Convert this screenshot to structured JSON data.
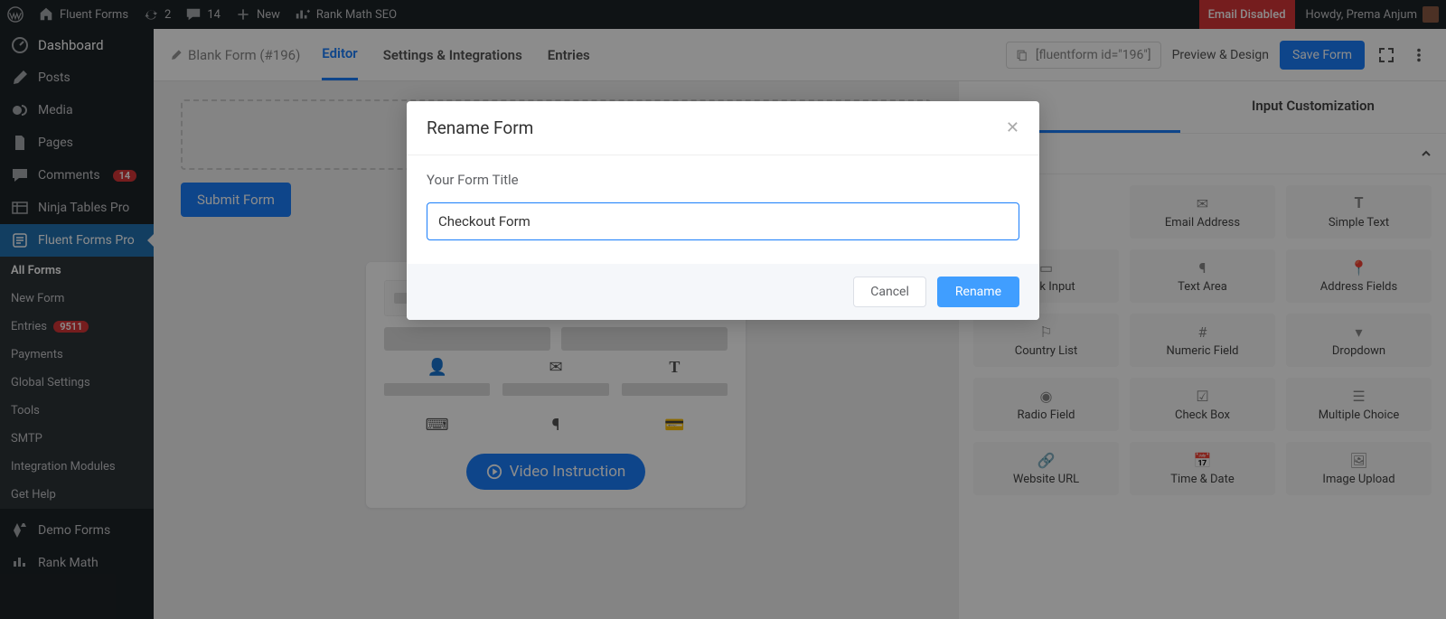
{
  "adminbar": {
    "site_name": "Fluent Forms",
    "updates": "2",
    "comments": "14",
    "new": "New",
    "rankmath": "Rank Math SEO",
    "email_disabled": "Email Disabled",
    "howdy": "Howdy, Prema Anjum"
  },
  "sidebar": {
    "items": [
      {
        "label": "Dashboard"
      },
      {
        "label": "Posts"
      },
      {
        "label": "Media"
      },
      {
        "label": "Pages"
      },
      {
        "label": "Comments",
        "badge": "14"
      },
      {
        "label": "Ninja Tables Pro"
      },
      {
        "label": "Fluent Forms Pro"
      }
    ],
    "subs": [
      {
        "label": "All Forms"
      },
      {
        "label": "New Form"
      },
      {
        "label": "Entries",
        "badge": "9511"
      },
      {
        "label": "Payments"
      },
      {
        "label": "Global Settings"
      },
      {
        "label": "Tools"
      },
      {
        "label": "SMTP"
      },
      {
        "label": "Integration Modules"
      },
      {
        "label": "Get Help"
      }
    ],
    "bottom": [
      {
        "label": "Demo Forms"
      },
      {
        "label": "Rank Math"
      }
    ]
  },
  "formbar": {
    "title": "Blank Form (#196)",
    "tabs": {
      "editor": "Editor",
      "settings": "Settings & Integrations",
      "entries": "Entries"
    },
    "shortcode": "[fluentform id=\"196\"]",
    "preview": "Preview & Design",
    "save": "Save Form"
  },
  "canvas": {
    "submit": "Submit Form",
    "video": "Video Instruction"
  },
  "right": {
    "tab_input": "Input Customization",
    "fields": [
      {
        "name": "email-address",
        "label": "Email Address",
        "glyph": "✉"
      },
      {
        "name": "simple-text",
        "label": "Simple Text",
        "glyph": "𝐓"
      },
      {
        "name": "mask-input",
        "label": "Mask Input",
        "glyph": "▭"
      },
      {
        "name": "text-area",
        "label": "Text Area",
        "glyph": "¶"
      },
      {
        "name": "address-fields",
        "label": "Address Fields",
        "glyph": "📍"
      },
      {
        "name": "country-list",
        "label": "Country List",
        "glyph": "⚐"
      },
      {
        "name": "numeric-field",
        "label": "Numeric Field",
        "glyph": "#"
      },
      {
        "name": "dropdown",
        "label": "Dropdown",
        "glyph": "▾"
      },
      {
        "name": "radio-field",
        "label": "Radio Field",
        "glyph": "◉"
      },
      {
        "name": "check-box",
        "label": "Check Box",
        "glyph": "☑"
      },
      {
        "name": "multiple-choice",
        "label": "Multiple Choice",
        "glyph": "☰"
      },
      {
        "name": "website-url",
        "label": "Website URL",
        "glyph": "🔗"
      },
      {
        "name": "time-date",
        "label": "Time & Date",
        "glyph": "📅"
      },
      {
        "name": "image-upload",
        "label": "Image Upload",
        "glyph": "🖼"
      }
    ]
  },
  "modal": {
    "title": "Rename Form",
    "label": "Your Form Title",
    "value": "Checkout Form",
    "cancel": "Cancel",
    "rename": "Rename"
  }
}
